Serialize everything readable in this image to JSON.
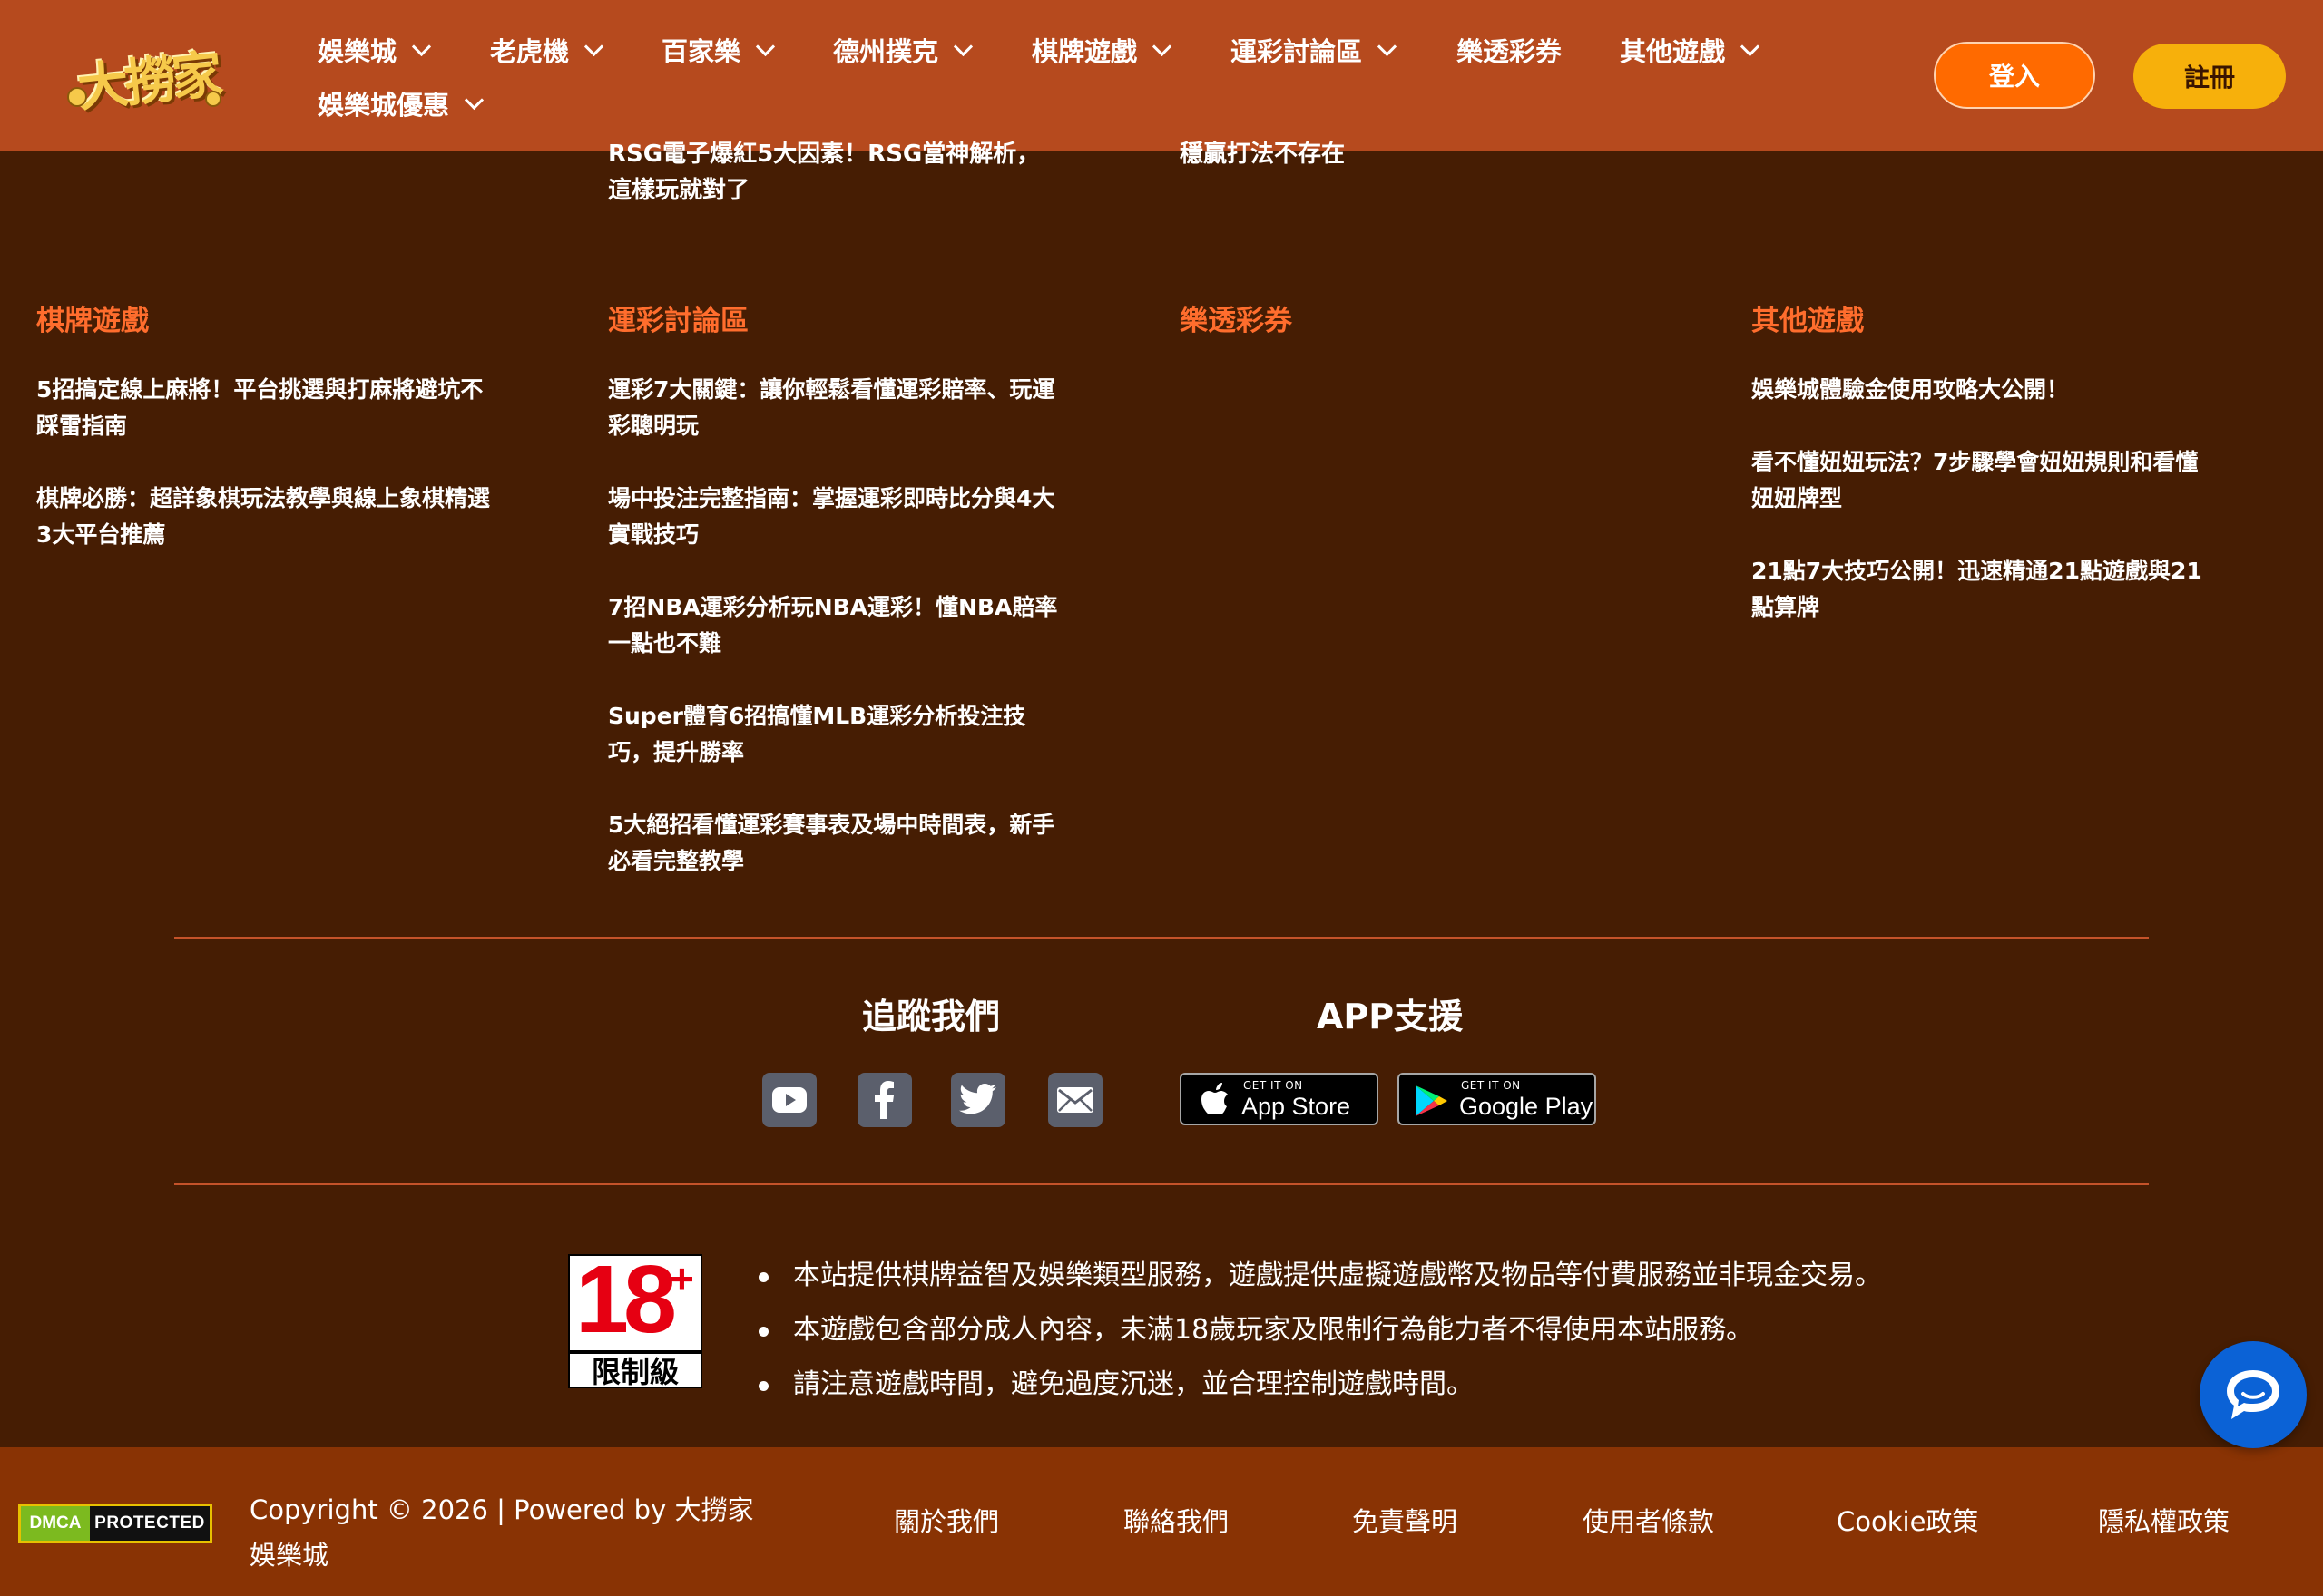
{
  "header": {
    "logo_text": "大撈家",
    "nav": [
      {
        "label": "娛樂城",
        "has_dropdown": true
      },
      {
        "label": "老虎機",
        "has_dropdown": true
      },
      {
        "label": "百家樂",
        "has_dropdown": true
      },
      {
        "label": "德州撲克",
        "has_dropdown": true
      },
      {
        "label": "棋牌遊戲",
        "has_dropdown": true
      },
      {
        "label": "運彩討論區",
        "has_dropdown": true
      },
      {
        "label": "樂透彩券",
        "has_dropdown": false
      },
      {
        "label": "其他遊戲",
        "has_dropdown": true
      },
      {
        "label": "娛樂城優惠",
        "has_dropdown": true
      }
    ],
    "login_label": "登入",
    "register_label": "註冊"
  },
  "clipped_top": {
    "col2": "RSG電子爆紅5大因素！RSG當神解析，這樣玩就對了",
    "col3": "穩贏打法不存在"
  },
  "columns": [
    {
      "heading": "棋牌遊戲",
      "links": [
        "5招搞定線上麻將！平台挑選與打麻將避坑不踩雷指南",
        "棋牌必勝：超詳象棋玩法教學與線上象棋精選3大平台推薦"
      ]
    },
    {
      "heading": "運彩討論區",
      "links": [
        "運彩7大關鍵：讓你輕鬆看懂運彩賠率、玩運彩聰明玩",
        "場中投注完整指南：掌握運彩即時比分與4大實戰技巧",
        "7招NBA運彩分析玩NBA運彩！懂NBA賠率一點也不難",
        "Super體育6招搞懂MLB運彩分析投注技巧，提升勝率",
        "5大絕招看懂運彩賽事表及場中時間表，新手必看完整教學"
      ]
    },
    {
      "heading": "樂透彩券",
      "links": []
    },
    {
      "heading": "其他遊戲",
      "links": [
        "娛樂城體驗金使用攻略大公開！",
        "看不懂妞妞玩法？7步驟學會妞妞規則和看懂妞妞牌型",
        "21點7大技巧公開！迅速精通21點遊戲與21點算牌"
      ]
    }
  ],
  "follow": {
    "title": "追蹤我們",
    "icons": [
      "youtube-icon",
      "facebook-icon",
      "twitter-icon",
      "mail-icon"
    ]
  },
  "app": {
    "title": "APP支援",
    "appstore_small": "GET IT ON",
    "appstore_big": "App Store",
    "googleplay_small": "GET IT ON",
    "googleplay_big": "Google Play"
  },
  "age_notice": {
    "badge_number": "18",
    "badge_plus": "+",
    "badge_label": "限制級",
    "items": [
      "本站提供棋牌益智及娛樂類型服務，遊戲提供虛擬遊戲幣及物品等付費服務並非現金交易。",
      "本遊戲包含部分成人內容，未滿18歲玩家及限制行為能力者不得使用本站服務。",
      "請注意遊戲時間，避免過度沉迷，並合理控制遊戲時間。"
    ]
  },
  "footer": {
    "dmca_left": "DMCA",
    "dmca_right": "PROTECTED",
    "copyright": "Copyright © 2026 | Powered by 大撈家娛樂城",
    "links": [
      "關於我們",
      "聯絡我們",
      "免責聲明",
      "使用者條款",
      "Cookie政策",
      "隱私權政策"
    ]
  },
  "colors": {
    "header_bg": "#b64a1e",
    "page_bg": "#461d03",
    "footer_bg": "#893304",
    "heading_orange": "#ff6d2d",
    "login_btn": "#ff6a00",
    "register_btn": "#f7b00b",
    "chat_btn": "#0b62d6"
  }
}
